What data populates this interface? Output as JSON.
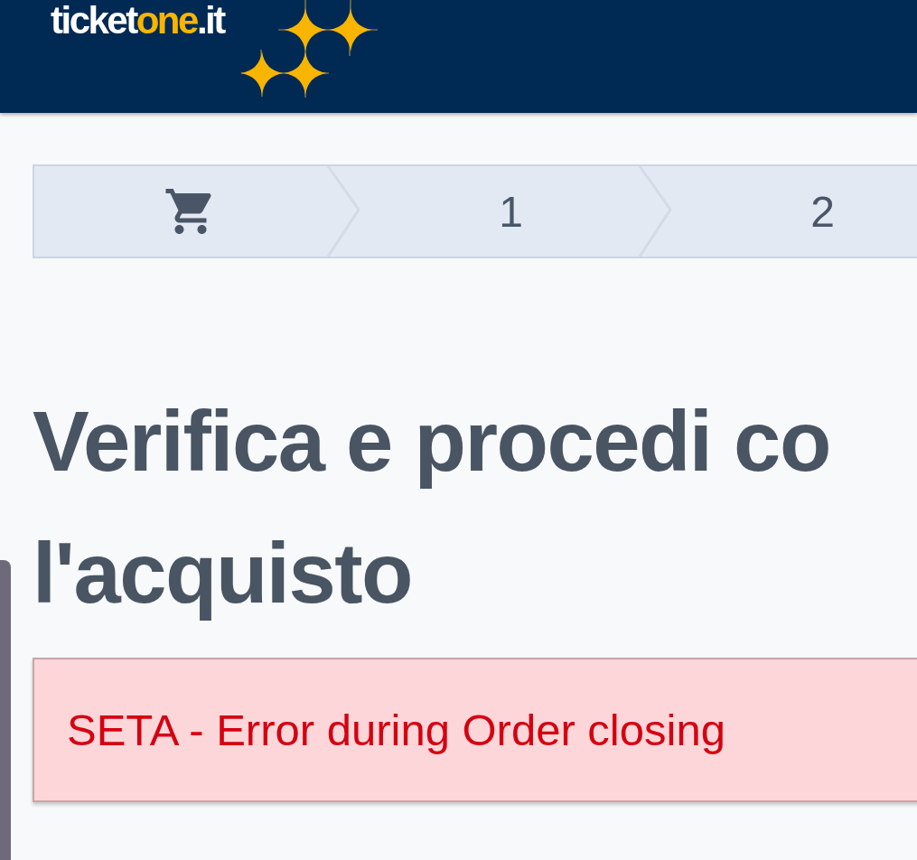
{
  "header": {
    "logo": {
      "prefix": "ticket",
      "highlight": "one",
      "suffix": ".it"
    }
  },
  "steps": [
    {
      "kind": "cart"
    },
    {
      "kind": "number",
      "label": "1"
    },
    {
      "kind": "number",
      "label": "2"
    }
  ],
  "title_lines": [
    "Verifica e procedi co",
    "l'acquisto"
  ],
  "error": {
    "message": "SETA - Error during Order closing"
  }
}
